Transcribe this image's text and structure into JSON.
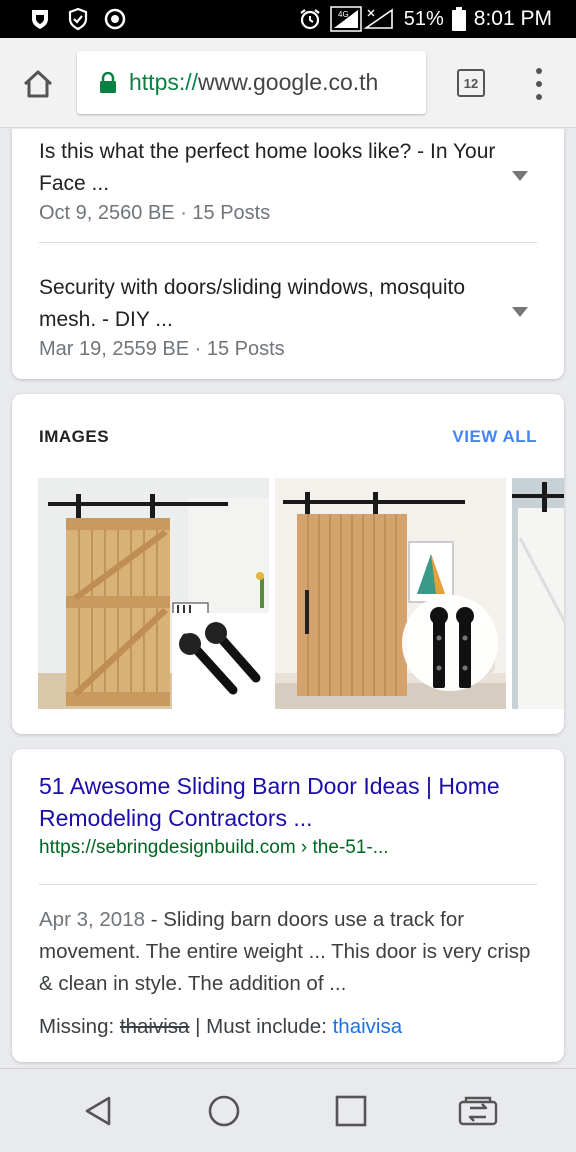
{
  "status_bar": {
    "battery_percent": "51%",
    "time": "8:01 PM",
    "network_label": "4G",
    "icons": [
      "shield-outline-icon",
      "shield-check-icon",
      "record-icon",
      "alarm-icon",
      "signal-icon",
      "battery-icon"
    ]
  },
  "toolbar": {
    "url_scheme": "https://",
    "url_host": "www.google.co.th",
    "tab_count": "12"
  },
  "forum_results": [
    {
      "title": "Is this what the perfect home looks like? - In Your Face ...",
      "meta": "Oct 9, 2560 BE · 15 Posts"
    },
    {
      "title": "Security with doors/sliding windows, mosquito mesh. - DIY ...",
      "meta": "Mar 19, 2559 BE · 15 Posts"
    }
  ],
  "images_section": {
    "label": "IMAGES",
    "view_all": "VIEW ALL",
    "images": [
      "barn-door-z-brace-with-hardware",
      "barn-door-vertical-planks-with-rollers",
      "white-barn-door-partial"
    ]
  },
  "result": {
    "title": "51 Awesome Sliding Barn Door Ideas | Home Remodeling Contractors ...",
    "url": "https://sebringdesignbuild.com › the-51-...",
    "date": "Apr 3, 2018",
    "snippet": " - Sliding barn doors use a track for movement. The entire weight ... This door is very crisp & clean in style. The addition of ...",
    "missing_label": "Missing: ",
    "missing_term": "thaivisa",
    "must_include_label": " | Must include: ",
    "must_include_term": "thaivisa"
  },
  "colors": {
    "link": "#1a0dab",
    "url_green": "#006621",
    "accent_blue": "#4285f4",
    "secure_green": "#0b8043"
  }
}
